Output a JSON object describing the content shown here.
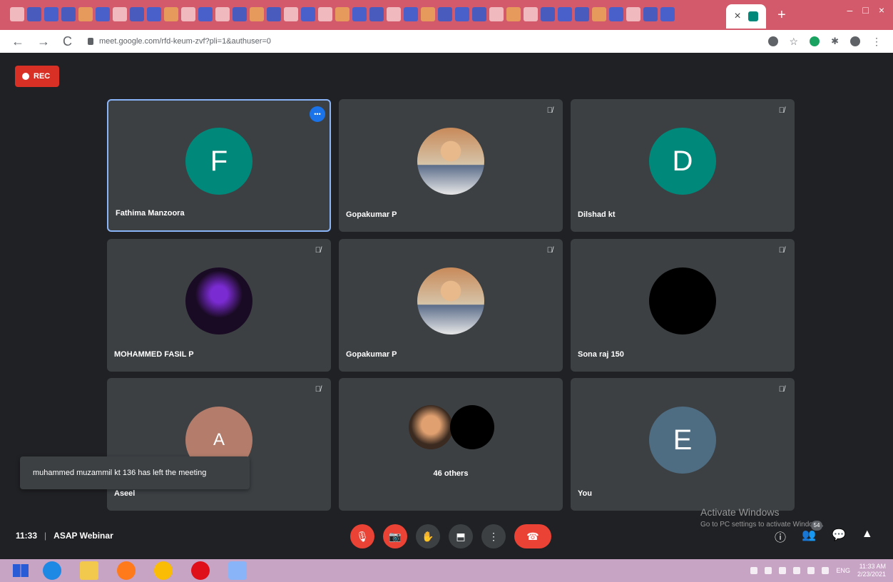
{
  "browser": {
    "active_tab_close": "×",
    "new_tab": "+",
    "url": "meet.google.com/rfd-keum-zvf?pli=1&authuser=0",
    "back": "←",
    "forward": "→",
    "reload": "C",
    "window_controls": [
      "–",
      "□",
      "×"
    ]
  },
  "rec_label": "REC",
  "tiles": [
    {
      "name": "Fathima Manzoora",
      "initial": "F",
      "avatar_color": "#00897b",
      "selected": true
    },
    {
      "name": "Gopakumar P",
      "photo": true
    },
    {
      "name": "Dilshad kt",
      "initial": "D",
      "avatar_color": "#00897b"
    },
    {
      "name": "MOHAMMED FASIL P",
      "photo": "masked"
    },
    {
      "name": "Gopakumar P",
      "photo": true
    },
    {
      "name": "Sona raj 150",
      "photo": "black"
    },
    {
      "name": "Aseel",
      "initial": "A",
      "avatar_color": "#b37c6b"
    },
    {
      "others_label": "46 others"
    },
    {
      "name": "You",
      "initial": "E",
      "avatar_color": "#4e6c82"
    }
  ],
  "toast": "muhammed muzammil kt 136 has left the meeting",
  "meeting": {
    "time": "11:33",
    "separator": "|",
    "title": "ASAP Webinar"
  },
  "participants_count": "54",
  "watermark": {
    "line1": "Activate Windows",
    "line2": "Go to PC settings to activate Windows."
  },
  "taskbar": {
    "lang": "ENG",
    "time": "11:33 AM",
    "date": "2/23/2021"
  },
  "colors": {
    "end_call": "#ea4335",
    "accent": "#1a73e8",
    "tile": "#3c4043",
    "background": "#202124"
  }
}
